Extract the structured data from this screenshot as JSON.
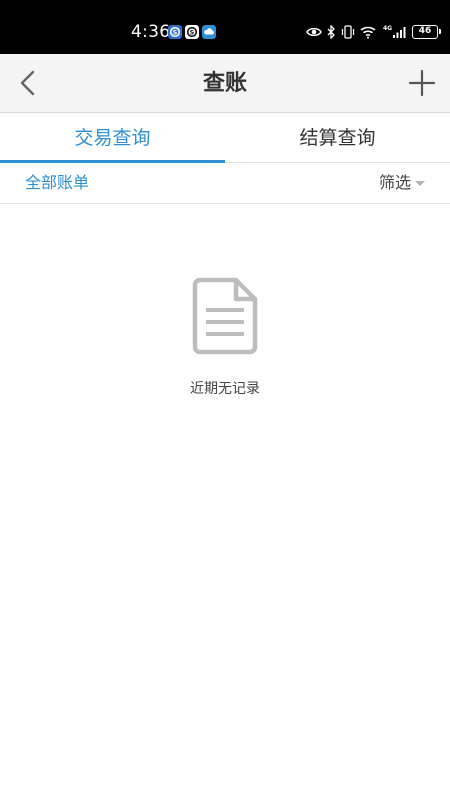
{
  "status_bar": {
    "time": "4:36",
    "battery": "46",
    "network": "4G"
  },
  "nav": {
    "title": "查账"
  },
  "tabs": [
    {
      "label": "交易查询",
      "active": true
    },
    {
      "label": "结算查询",
      "active": false
    }
  ],
  "filter": {
    "all_bills": "全部账单",
    "filter_label": "筛选"
  },
  "empty_state": {
    "message": "近期无记录"
  },
  "colors": {
    "accent": "#2f8fd4",
    "nav_background": "#f4f4f4",
    "icon_gray": "#bdbdbd"
  }
}
